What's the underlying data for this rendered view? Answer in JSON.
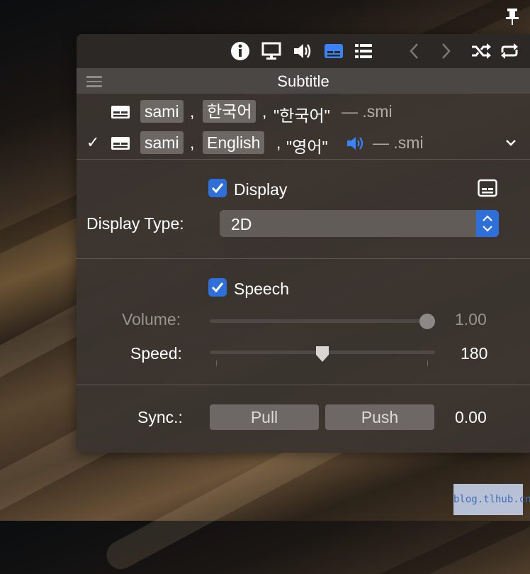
{
  "toolbar": {
    "icons": [
      "info-icon",
      "display-icon",
      "volume-icon",
      "subtitle-icon",
      "list-icon",
      "chevron-left-icon",
      "chevron-right-icon",
      "shuffle-icon",
      "repeat-icon"
    ],
    "active_color": "#3b82f6"
  },
  "header": {
    "title": "Subtitle"
  },
  "tracks": [
    {
      "checked": false,
      "codec": "sami",
      "language": "한국어",
      "name": "\"한국어\"",
      "ext": "— .smi"
    },
    {
      "checked": true,
      "check_mark": "✓",
      "codec": "sami",
      "language": "English",
      "name": "\"영어\"",
      "ext": "— .smi"
    }
  ],
  "display": {
    "checkbox_label": "Display",
    "type_label": "Display Type:",
    "type_value": "2D"
  },
  "speech": {
    "checkbox_label": "Speech",
    "volume_label": "Volume:",
    "volume_value": "1.00",
    "volume_level": 1.0,
    "speed_label": "Speed:",
    "speed_value": "180",
    "speed_level": 0.5
  },
  "sync": {
    "label": "Sync.:",
    "pull_label": "Pull",
    "push_label": "Push",
    "value": "0.00"
  },
  "watermark": "blog.tlhub.cn"
}
